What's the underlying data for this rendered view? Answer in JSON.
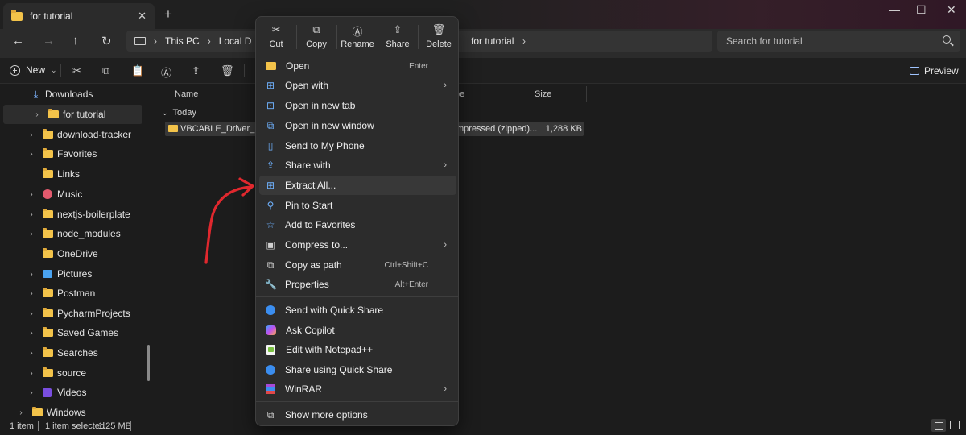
{
  "window": {
    "tab_title": "for tutorial",
    "tab_close": "✕",
    "new_tab": "+",
    "controls": {
      "minimize": "—",
      "maximize": "☐",
      "close": "✕"
    }
  },
  "nav": {
    "back": "←",
    "forward": "→",
    "up": "↑",
    "refresh": "↻"
  },
  "address": {
    "crumbs": [
      "This PC",
      "Local D"
    ],
    "last_crumb": "for tutorial",
    "chevron": "›"
  },
  "search": {
    "placeholder": "Search for tutorial"
  },
  "toolbar": {
    "new_label": "New",
    "new_caret": "⌄",
    "cut": "✂",
    "copy": "⧉",
    "paste": "📋",
    "rename": "Ⓐ",
    "share": "⇪",
    "delete": "🗑",
    "preview_label": "Preview"
  },
  "sidebar": {
    "items": [
      {
        "label": "Downloads",
        "expander": "›"
      },
      {
        "label": "for tutorial",
        "expander": "›"
      },
      {
        "label": "download-tracker",
        "expander": "›"
      },
      {
        "label": "Favorites",
        "expander": "›"
      },
      {
        "label": "Links",
        "expander": ""
      },
      {
        "label": "Music",
        "expander": "›"
      },
      {
        "label": "nextjs-boilerplate",
        "expander": "›"
      },
      {
        "label": "node_modules",
        "expander": "›"
      },
      {
        "label": "OneDrive",
        "expander": ""
      },
      {
        "label": "Pictures",
        "expander": "›"
      },
      {
        "label": "Postman",
        "expander": "›"
      },
      {
        "label": "PycharmProjects",
        "expander": "›"
      },
      {
        "label": "Saved Games",
        "expander": "›"
      },
      {
        "label": "Searches",
        "expander": "›"
      },
      {
        "label": "source",
        "expander": "›"
      },
      {
        "label": "Videos",
        "expander": "›"
      },
      {
        "label": "Windows",
        "expander": "›"
      }
    ]
  },
  "files": {
    "columns": {
      "name": "Name",
      "type": "pe",
      "size": "Size"
    },
    "group": {
      "label": "Today",
      "caret": "⌄"
    },
    "rows": [
      {
        "name": "VBCABLE_Driver_Pack45",
        "type": "mpressed (zipped)...",
        "size": "1,288 KB"
      }
    ]
  },
  "status": {
    "count": "1 item",
    "selected": "1 item selected",
    "size": "1.25 MB"
  },
  "context_menu": {
    "quick_actions": [
      {
        "label": "Cut",
        "icon": "✂"
      },
      {
        "label": "Copy",
        "icon": "⧉"
      },
      {
        "label": "Rename",
        "icon": "Ⓐ"
      },
      {
        "label": "Share",
        "icon": "⇪"
      },
      {
        "label": "Delete",
        "icon": "🗑"
      }
    ],
    "items": {
      "open": {
        "label": "Open",
        "shortcut": "Enter"
      },
      "open_with": {
        "label": "Open with",
        "icon": "⊞",
        "arrow": "›"
      },
      "open_new_tab": {
        "label": "Open in new tab",
        "icon": "⊡"
      },
      "open_new_window": {
        "label": "Open in new window",
        "icon": "⧉"
      },
      "send_phone": {
        "label": "Send to My Phone",
        "icon": "▯"
      },
      "share_with": {
        "label": "Share with",
        "icon": "⇪",
        "arrow": "›"
      },
      "extract_all": {
        "label": "Extract All...",
        "icon": "⊞"
      },
      "pin_start": {
        "label": "Pin to Start",
        "icon": "⚲"
      },
      "add_favorites": {
        "label": "Add to Favorites",
        "icon": "☆"
      },
      "compress": {
        "label": "Compress to...",
        "icon": "▣",
        "arrow": "›"
      },
      "copy_path": {
        "label": "Copy as path",
        "icon": "⧉",
        "shortcut": "Ctrl+Shift+C"
      },
      "properties": {
        "label": "Properties",
        "icon": "🔧",
        "shortcut": "Alt+Enter"
      },
      "send_quick_share": {
        "label": "Send with Quick Share"
      },
      "ask_copilot": {
        "label": "Ask Copilot"
      },
      "edit_notepad": {
        "label": "Edit with Notepad++"
      },
      "share_quick_share": {
        "label": "Share using Quick Share"
      },
      "winrar": {
        "label": "WinRAR",
        "arrow": "›"
      },
      "more_options": {
        "label": "Show more options",
        "icon": "⧉"
      }
    }
  },
  "colors": {
    "accent": "#6fb2ff",
    "annotation": "#e0282e",
    "folder": "#f3c34a"
  }
}
